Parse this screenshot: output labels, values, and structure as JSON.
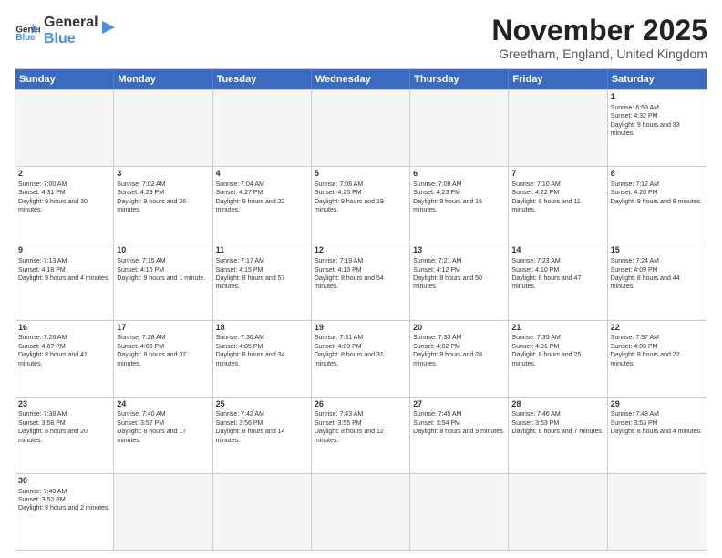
{
  "logo": {
    "general": "General",
    "blue": "Blue"
  },
  "header": {
    "title": "November 2025",
    "subtitle": "Greetham, England, United Kingdom"
  },
  "days": [
    "Sunday",
    "Monday",
    "Tuesday",
    "Wednesday",
    "Thursday",
    "Friday",
    "Saturday"
  ],
  "rows": [
    [
      {
        "day": "",
        "empty": true
      },
      {
        "day": "",
        "empty": true
      },
      {
        "day": "",
        "empty": true
      },
      {
        "day": "",
        "empty": true
      },
      {
        "day": "",
        "empty": true
      },
      {
        "day": "",
        "empty": true
      },
      {
        "day": "1",
        "rise": "Sunrise: 6:59 AM",
        "set": "Sunset: 4:32 PM",
        "light": "Daylight: 9 hours and 33 minutes."
      }
    ],
    [
      {
        "day": "2",
        "rise": "Sunrise: 7:00 AM",
        "set": "Sunset: 4:31 PM",
        "light": "Daylight: 9 hours and 30 minutes."
      },
      {
        "day": "3",
        "rise": "Sunrise: 7:02 AM",
        "set": "Sunset: 4:29 PM",
        "light": "Daylight: 9 hours and 26 minutes."
      },
      {
        "day": "4",
        "rise": "Sunrise: 7:04 AM",
        "set": "Sunset: 4:27 PM",
        "light": "Daylight: 9 hours and 22 minutes."
      },
      {
        "day": "5",
        "rise": "Sunrise: 7:06 AM",
        "set": "Sunset: 4:25 PM",
        "light": "Daylight: 9 hours and 19 minutes."
      },
      {
        "day": "6",
        "rise": "Sunrise: 7:08 AM",
        "set": "Sunset: 4:23 PM",
        "light": "Daylight: 9 hours and 15 minutes."
      },
      {
        "day": "7",
        "rise": "Sunrise: 7:10 AM",
        "set": "Sunset: 4:22 PM",
        "light": "Daylight: 9 hours and 11 minutes."
      },
      {
        "day": "8",
        "rise": "Sunrise: 7:12 AM",
        "set": "Sunset: 4:20 PM",
        "light": "Daylight: 9 hours and 8 minutes."
      }
    ],
    [
      {
        "day": "9",
        "rise": "Sunrise: 7:13 AM",
        "set": "Sunset: 4:18 PM",
        "light": "Daylight: 9 hours and 4 minutes."
      },
      {
        "day": "10",
        "rise": "Sunrise: 7:15 AM",
        "set": "Sunset: 4:16 PM",
        "light": "Daylight: 9 hours and 1 minute."
      },
      {
        "day": "11",
        "rise": "Sunrise: 7:17 AM",
        "set": "Sunset: 4:15 PM",
        "light": "Daylight: 8 hours and 57 minutes."
      },
      {
        "day": "12",
        "rise": "Sunrise: 7:19 AM",
        "set": "Sunset: 4:13 PM",
        "light": "Daylight: 8 hours and 54 minutes."
      },
      {
        "day": "13",
        "rise": "Sunrise: 7:21 AM",
        "set": "Sunset: 4:12 PM",
        "light": "Daylight: 8 hours and 50 minutes."
      },
      {
        "day": "14",
        "rise": "Sunrise: 7:23 AM",
        "set": "Sunset: 4:10 PM",
        "light": "Daylight: 8 hours and 47 minutes."
      },
      {
        "day": "15",
        "rise": "Sunrise: 7:24 AM",
        "set": "Sunset: 4:09 PM",
        "light": "Daylight: 8 hours and 44 minutes."
      }
    ],
    [
      {
        "day": "16",
        "rise": "Sunrise: 7:26 AM",
        "set": "Sunset: 4:07 PM",
        "light": "Daylight: 8 hours and 41 minutes."
      },
      {
        "day": "17",
        "rise": "Sunrise: 7:28 AM",
        "set": "Sunset: 4:06 PM",
        "light": "Daylight: 8 hours and 37 minutes."
      },
      {
        "day": "18",
        "rise": "Sunrise: 7:30 AM",
        "set": "Sunset: 4:05 PM",
        "light": "Daylight: 8 hours and 34 minutes."
      },
      {
        "day": "19",
        "rise": "Sunrise: 7:31 AM",
        "set": "Sunset: 4:03 PM",
        "light": "Daylight: 8 hours and 31 minutes."
      },
      {
        "day": "20",
        "rise": "Sunrise: 7:33 AM",
        "set": "Sunset: 4:02 PM",
        "light": "Daylight: 8 hours and 28 minutes."
      },
      {
        "day": "21",
        "rise": "Sunrise: 7:35 AM",
        "set": "Sunset: 4:01 PM",
        "light": "Daylight: 8 hours and 25 minutes."
      },
      {
        "day": "22",
        "rise": "Sunrise: 7:37 AM",
        "set": "Sunset: 4:00 PM",
        "light": "Daylight: 8 hours and 22 minutes."
      }
    ],
    [
      {
        "day": "23",
        "rise": "Sunrise: 7:38 AM",
        "set": "Sunset: 3:58 PM",
        "light": "Daylight: 8 hours and 20 minutes."
      },
      {
        "day": "24",
        "rise": "Sunrise: 7:40 AM",
        "set": "Sunset: 3:57 PM",
        "light": "Daylight: 8 hours and 17 minutes."
      },
      {
        "day": "25",
        "rise": "Sunrise: 7:42 AM",
        "set": "Sunset: 3:56 PM",
        "light": "Daylight: 8 hours and 14 minutes."
      },
      {
        "day": "26",
        "rise": "Sunrise: 7:43 AM",
        "set": "Sunset: 3:55 PM",
        "light": "Daylight: 8 hours and 12 minutes."
      },
      {
        "day": "27",
        "rise": "Sunrise: 7:45 AM",
        "set": "Sunset: 3:54 PM",
        "light": "Daylight: 8 hours and 9 minutes."
      },
      {
        "day": "28",
        "rise": "Sunrise: 7:46 AM",
        "set": "Sunset: 3:53 PM",
        "light": "Daylight: 8 hours and 7 minutes."
      },
      {
        "day": "29",
        "rise": "Sunrise: 7:48 AM",
        "set": "Sunset: 3:53 PM",
        "light": "Daylight: 8 hours and 4 minutes."
      }
    ],
    [
      {
        "day": "30",
        "rise": "Sunrise: 7:49 AM",
        "set": "Sunset: 3:52 PM",
        "light": "Daylight: 8 hours and 2 minutes."
      },
      {
        "day": "",
        "empty": true
      },
      {
        "day": "",
        "empty": true
      },
      {
        "day": "",
        "empty": true
      },
      {
        "day": "",
        "empty": true
      },
      {
        "day": "",
        "empty": true
      },
      {
        "day": "",
        "empty": true
      }
    ]
  ]
}
